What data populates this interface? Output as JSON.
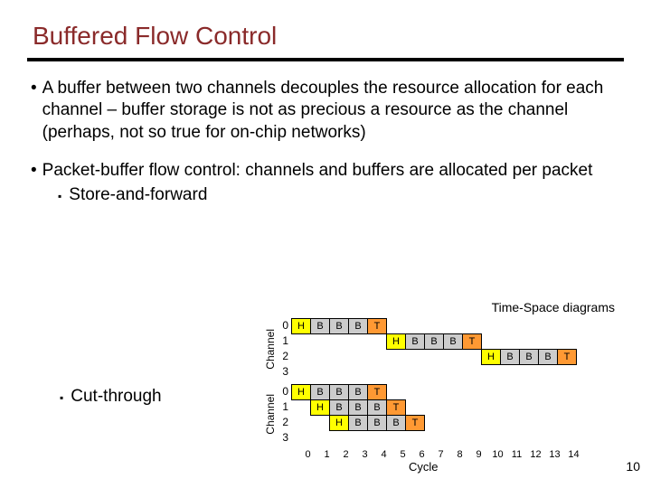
{
  "title": "Buffered Flow Control",
  "bullet1": "A buffer between two channels decouples the resource allocation for each channel – buffer storage is not as precious a resource as the channel  (perhaps, not so true for on-chip networks)",
  "bullet2": "Packet-buffer flow control: channels and buffers are allocated per packet",
  "sub_saf": "Store-and-forward",
  "sub_cut": "Cut-through",
  "caption": "Time-Space diagrams",
  "ylabel": "Channel",
  "xlabel": "Cycle",
  "page": "10",
  "chart_data": [
    {
      "type": "table",
      "name": "store-and-forward",
      "y_label": "Channel",
      "rows": [
        "0",
        "1",
        "2",
        "3"
      ],
      "grid": [
        [
          "H",
          "B",
          "B",
          "B",
          "T",
          "",
          "",
          "",
          "",
          "",
          "",
          "",
          "",
          "",
          ""
        ],
        [
          "",
          "",
          "",
          "",
          "",
          "H",
          "B",
          "B",
          "B",
          "T",
          "",
          "",
          "",
          "",
          ""
        ],
        [
          "",
          "",
          "",
          "",
          "",
          "",
          "",
          "",
          "",
          "",
          "H",
          "B",
          "B",
          "B",
          "T"
        ],
        [
          "",
          "",
          "",
          "",
          "",
          "",
          "",
          "",
          "",
          "",
          "",
          "",
          "",
          "",
          ""
        ]
      ]
    },
    {
      "type": "table",
      "name": "cut-through",
      "y_label": "Channel",
      "x_label": "Cycle",
      "rows": [
        "0",
        "1",
        "2",
        "3"
      ],
      "x_ticks": [
        "0",
        "1",
        "2",
        "3",
        "4",
        "5",
        "6",
        "7",
        "8",
        "9",
        "10",
        "11",
        "12",
        "13",
        "14"
      ],
      "grid": [
        [
          "H",
          "B",
          "B",
          "B",
          "T",
          "",
          "",
          "",
          "",
          "",
          "",
          "",
          "",
          "",
          ""
        ],
        [
          "",
          "H",
          "B",
          "B",
          "B",
          "T",
          "",
          "",
          "",
          "",
          "",
          "",
          "",
          "",
          ""
        ],
        [
          "",
          "",
          "H",
          "B",
          "B",
          "B",
          "T",
          "",
          "",
          "",
          "",
          "",
          "",
          "",
          ""
        ],
        [
          "",
          "",
          "",
          "",
          "",
          "",
          "",
          "",
          "",
          "",
          "",
          "",
          "",
          "",
          ""
        ]
      ]
    }
  ]
}
